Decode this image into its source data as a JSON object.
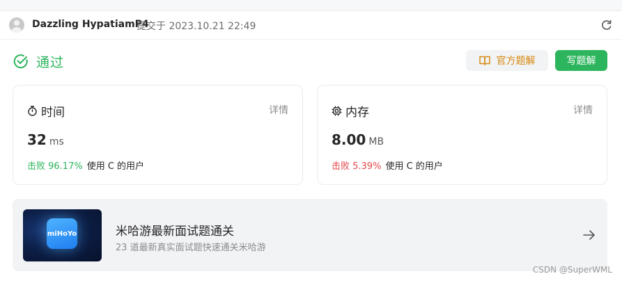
{
  "submission": {
    "username": "Dazzling HypatiamP4",
    "submitted_text": "提交于 2023.10.21 22:49"
  },
  "status": {
    "label": "通过",
    "color": "#2db55d"
  },
  "buttons": {
    "official_solution": "官方题解",
    "write_solution": "写题解"
  },
  "time_card": {
    "title": "时间",
    "detail_link": "详情",
    "value": "32",
    "unit": "ms",
    "beat_label": "击败 96.17%",
    "beat_suffix": "使用 C 的用户"
  },
  "memory_card": {
    "title": "内存",
    "detail_link": "详情",
    "value": "8.00",
    "unit": "MB",
    "beat_label": "击败 5.39%",
    "beat_suffix": "使用 C 的用户"
  },
  "promo": {
    "logo_text": "miHoYo",
    "title": "米哈游最新面试题通关",
    "subtitle": "23 道最新真实面试题快速通关米哈游"
  },
  "watermark": "CSDN @SuperWML",
  "icons": {
    "status": "check-circle-icon",
    "official": "book-icon",
    "time": "stopwatch-icon",
    "memory": "chip-icon",
    "refresh": "refresh-icon",
    "arrow": "arrow-right-icon"
  },
  "colors": {
    "accent_green": "#2db55d",
    "accent_orange": "#d68910",
    "danger_red": "#e5484d"
  }
}
